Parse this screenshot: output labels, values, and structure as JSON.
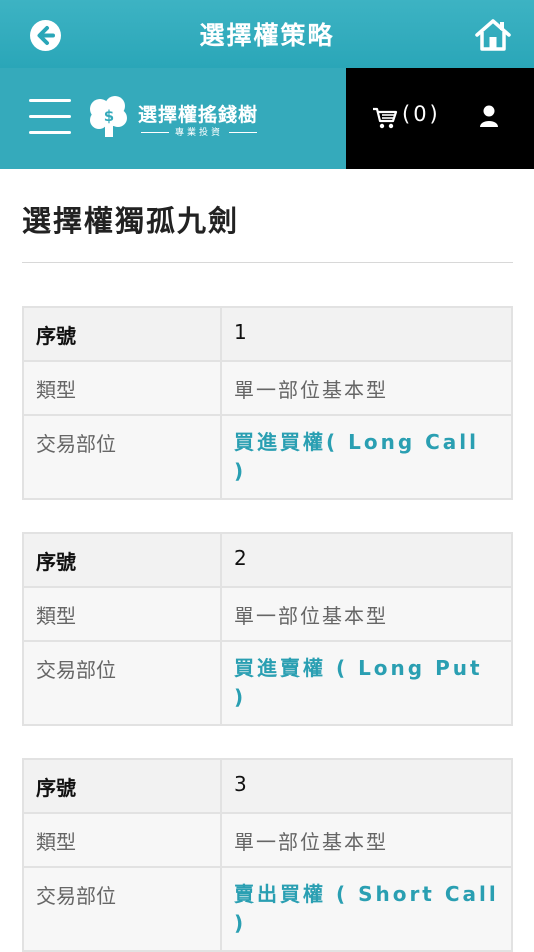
{
  "topbar": {
    "title": "選擇權策略"
  },
  "brand": {
    "name": "選擇權搖錢樹",
    "tagline": "專業投資"
  },
  "cart": {
    "count": "(0)"
  },
  "page": {
    "heading": "選擇權獨孤九劍"
  },
  "strategies": [
    {
      "seq_label": "序號",
      "seq": "1",
      "type_label": "類型",
      "type": "單一部位基本型",
      "position_label": "交易部位",
      "position": "買進買權( Long Call )"
    },
    {
      "seq_label": "序號",
      "seq": "2",
      "type_label": "類型",
      "type": "單一部位基本型",
      "position_label": "交易部位",
      "position": "買進賣權 ( Long Put )"
    },
    {
      "seq_label": "序號",
      "seq": "3",
      "type_label": "類型",
      "type": "單一部位基本型",
      "position_label": "交易部位",
      "position": "賣出買權 ( Short Call )"
    }
  ],
  "colors": {
    "accent": "#2aa6b8",
    "link": "#2a9fb2",
    "brand_black": "#000000"
  },
  "icons": [
    "back-arrow-icon",
    "home-icon",
    "hamburger-menu-icon",
    "money-tree-logo-icon",
    "cart-icon",
    "user-icon"
  ]
}
